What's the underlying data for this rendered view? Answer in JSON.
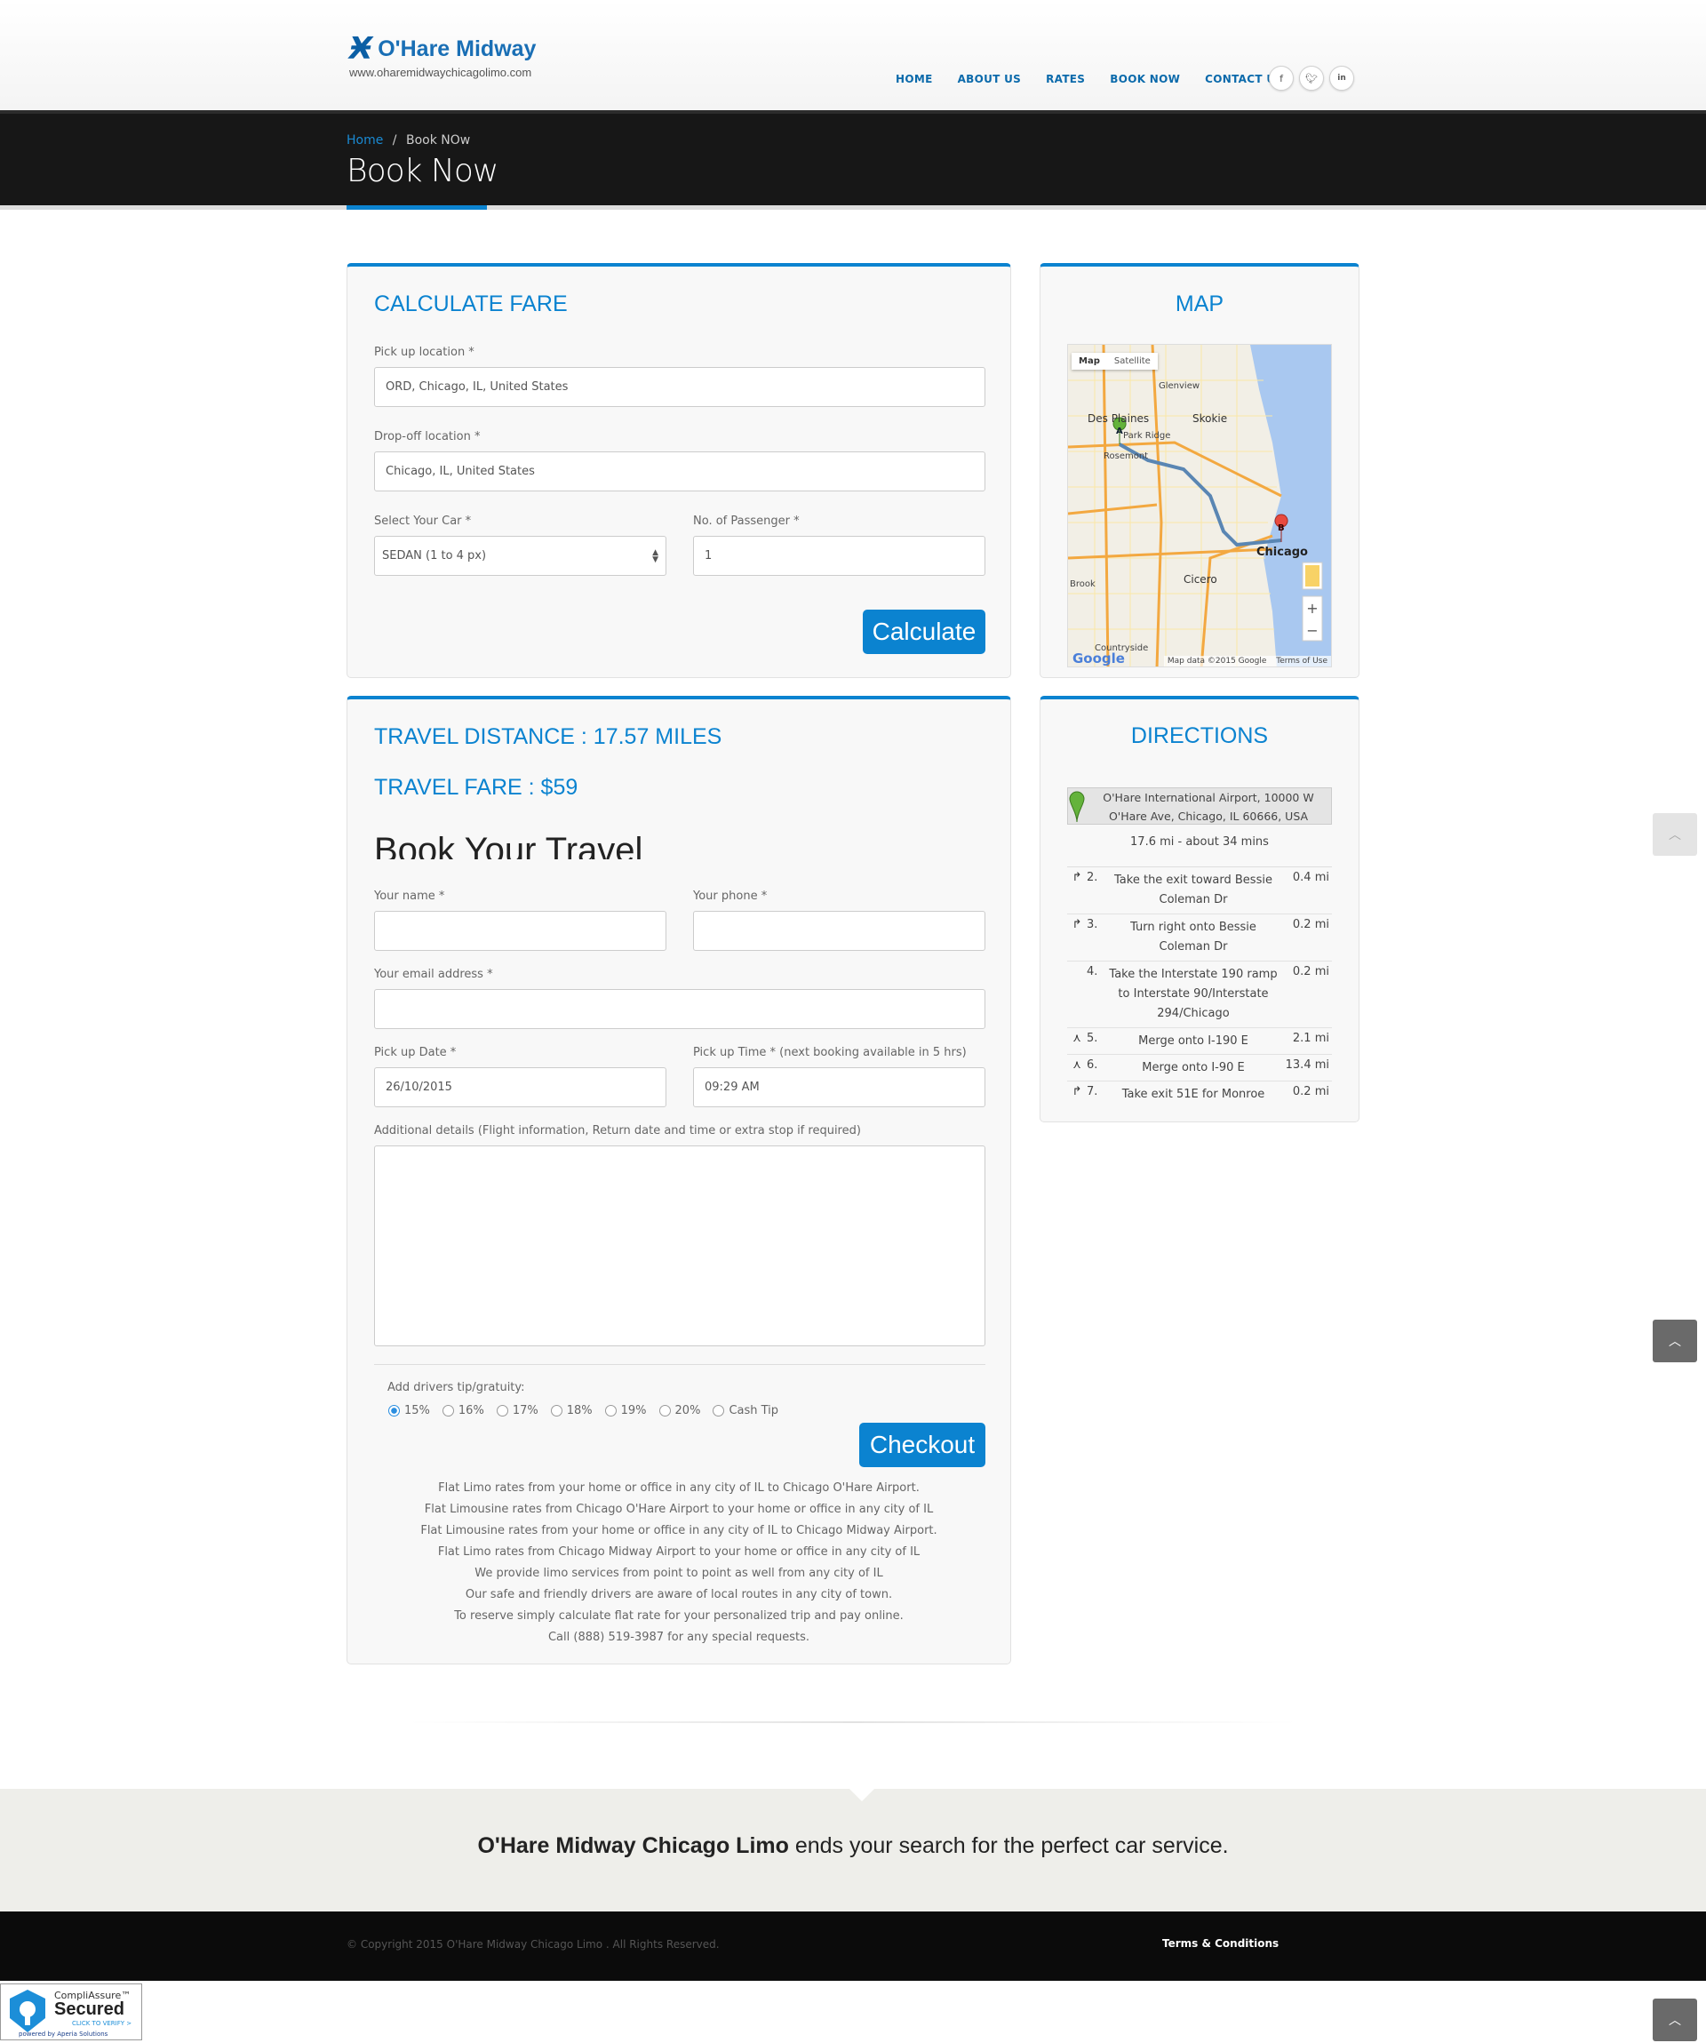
{
  "header": {
    "logo_title": "O'Hare Midway",
    "logo_url": "www.oharemidwaychicagolimo.com",
    "nav": [
      "HOME",
      "ABOUT US",
      "RATES",
      "BOOK NOW",
      "CONTACT US"
    ],
    "social": [
      "f",
      "t",
      "in"
    ]
  },
  "titlebar": {
    "crumb_home": "Home",
    "crumb_sep": "/",
    "crumb_current": "Book NOw",
    "title": "Book Now"
  },
  "calc": {
    "heading": "CALCULATE FARE",
    "pickup_label": "Pick up location *",
    "pickup_value": "ORD, Chicago, IL, United States",
    "dropoff_label": "Drop-off location *",
    "dropoff_value": "Chicago, IL, United States",
    "car_label": "Select Your Car *",
    "car_value": "SEDAN (1 to 4 px)",
    "pax_label": "No. of Passenger *",
    "pax_value": "1",
    "calc_button": "Calculate"
  },
  "booking": {
    "distance": "TRAVEL DISTANCE : 17.57 MILES",
    "fare": "TRAVEL FARE : $59",
    "heading": "Book Your Travel",
    "name_label": "Your name *",
    "phone_label": "Your phone *",
    "email_label": "Your email address *",
    "date_label": "Pick up Date *",
    "date_value": "26/10/2015",
    "time_label": "Pick up Time * (next booking available in 5 hrs)",
    "time_value": "09:29 AM",
    "details_label": "Additional details (Flight information, Return date and time or extra stop if required)",
    "tip_label": "Add drivers tip/gratuity:",
    "tips": [
      "15%",
      "16%",
      "17%",
      "18%",
      "19%",
      "20%",
      "Cash Tip"
    ],
    "tip_selected": "15%",
    "checkout_button": "Checkout",
    "promo": [
      "Flat Limo rates from your home or office in any city of IL to Chicago O'Hare Airport.",
      "Flat Limousine rates from Chicago O'Hare Airport to your home or office in any city of IL",
      "Flat Limousine rates from your home or office in any city of IL to Chicago Midway Airport.",
      "Flat Limo rates from Chicago Midway Airport to your home or office in any city of IL",
      "We provide limo services from point to point as well from any city of IL",
      "Our safe and friendly drivers are aware of local routes in any city of town.",
      "To reserve simply calculate flat rate for your personalized trip and pay online.",
      "Call (888) 519-3987 for any special requests."
    ]
  },
  "map": {
    "heading": "MAP",
    "tab_map": "Map",
    "tab_satellite": "Satellite",
    "labels": [
      "Glenview",
      "Des Plaines",
      "Skokie",
      "Park Ridge",
      "Rosemont",
      "Chicago",
      "Cicero",
      "Brook",
      "Countryside"
    ],
    "marker_a": "A",
    "marker_b": "B",
    "attribution": "Map data ©2015 Google",
    "terms": "Terms of Use",
    "google": "Google"
  },
  "directions": {
    "heading": "DIRECTIONS",
    "origin": "O'Hare International Airport, 10000 W O'Hare Ave, Chicago, IL 60666, USA",
    "summary": "17.6 mi - about 34 mins",
    "steps": [
      {
        "num": "2.",
        "text": "Take the exit toward Bessie Coleman Dr",
        "dist": "0.4 mi"
      },
      {
        "num": "3.",
        "text": "Turn right onto Bessie Coleman Dr",
        "dist": "0.2 mi"
      },
      {
        "num": "4.",
        "text": "Take the Interstate 190 ramp to Interstate 90/Interstate 294/Chicago",
        "dist": "0.2 mi"
      },
      {
        "num": "5.",
        "text": "Merge onto I-190 E",
        "dist": "2.1 mi"
      },
      {
        "num": "6.",
        "text": "Merge onto I-90 E",
        "dist": "13.4 mi"
      },
      {
        "num": "7.",
        "text": "Take exit 51E for Monroe",
        "dist": "0.2 mi"
      }
    ]
  },
  "strip": {
    "brand": "O'Hare Midway Chicago Limo",
    "tagline": " ends your search for the perfect car service."
  },
  "footer": {
    "copyright": "© Copyright 2015 O'Hare Midway Chicago Limo . All Rights Reserved.",
    "terms": "Terms & Conditions"
  },
  "trust": {
    "brand": "CompliAssure™",
    "title": "Secured",
    "cta": "CLICK TO VERIFY >",
    "powered": "powered by Aperia Solutions"
  },
  "colors": {
    "accent": "#0b83d0",
    "dark": "#171717"
  }
}
